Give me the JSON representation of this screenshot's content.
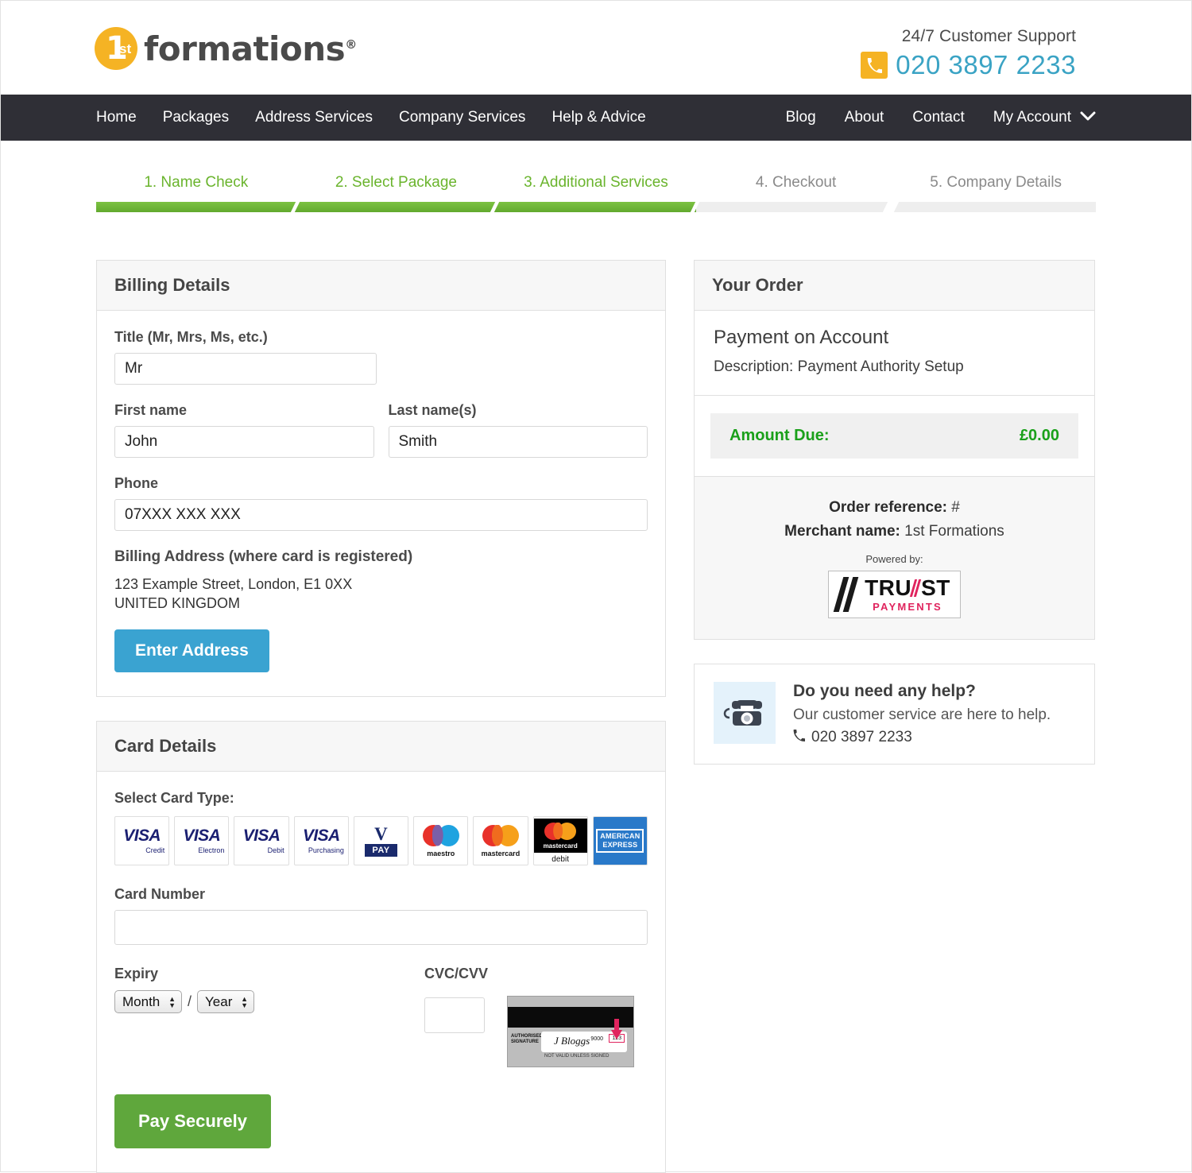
{
  "header": {
    "logo_digit": "1",
    "logo_sup": "st",
    "logo_word": "formations",
    "logo_registered": "®",
    "support_label": "24/7 Customer Support",
    "support_phone": "020 3897 2233",
    "phone_icon": "phone-icon",
    "accent_yellow": "#f5b324",
    "phone_blue": "#3aa3c4"
  },
  "nav": {
    "left_items": [
      "Home",
      "Packages",
      "Address Services",
      "Company Services",
      "Help & Advice"
    ],
    "right_items": [
      "Blog",
      "About",
      "Contact",
      "My Account"
    ],
    "caret_icon": "chevron-down-icon",
    "background": "#2f2f36"
  },
  "steps": {
    "items": [
      {
        "label": "1. Name Check",
        "state": "done"
      },
      {
        "label": "2. Select Package",
        "state": "done"
      },
      {
        "label": "3. Additional Services",
        "state": "done"
      },
      {
        "label": "4. Checkout",
        "state": "pending"
      },
      {
        "label": "5. Company Details",
        "state": "pending"
      }
    ],
    "done_color": "#6ab42d",
    "pending_color": "#8a8a8a"
  },
  "billing": {
    "panel_title": "Billing Details",
    "title_label": "Title (Mr, Mrs, Ms, etc.)",
    "title_value": "Mr",
    "first_name_label": "First name",
    "first_name_value": "John",
    "last_name_label": "Last name(s)",
    "last_name_value": "Smith",
    "phone_label": "Phone",
    "phone_value": "07XXX XXX XXX",
    "address_label": "Billing Address (where card is registered)",
    "address_line1": "123 Example Street, London, E1 0XX",
    "address_line2": "UNITED KINGDOM",
    "enter_address_button": "Enter Address",
    "button_color": "#3aa3d1"
  },
  "card": {
    "panel_title": "Card Details",
    "select_card_label": "Select Card Type:",
    "types": [
      {
        "name": "visa-credit",
        "brand": "VISA",
        "sub": "Credit"
      },
      {
        "name": "visa-electron",
        "brand": "VISA",
        "sub": "Electron"
      },
      {
        "name": "visa-debit",
        "brand": "VISA",
        "sub": "Debit"
      },
      {
        "name": "visa-purchasing",
        "brand": "VISA",
        "sub": "Purchasing"
      },
      {
        "name": "v-pay",
        "brand": "V",
        "sub": "PAY"
      },
      {
        "name": "maestro",
        "brand": "",
        "sub": "maestro"
      },
      {
        "name": "mastercard",
        "brand": "",
        "sub": "mastercard"
      },
      {
        "name": "mastercard-debit",
        "brand": "mastercard",
        "sub": "debit"
      },
      {
        "name": "american-express",
        "brand": "AMERICAN",
        "sub": "EXPRESS"
      }
    ],
    "card_number_label": "Card Number",
    "card_number_value": "",
    "expiry_label": "Expiry",
    "month_placeholder": "Month",
    "year_placeholder": "Year",
    "expiry_separator": "/",
    "cvc_label": "CVC/CVV",
    "cvc_value": "",
    "cvc_card": {
      "auth_text": "AUTHORISED SIGNATURE",
      "signature": "J Bloggs",
      "number_fragment": "9000",
      "cvc_digits": "123",
      "footer": "NOT VALID UNLESS SIGNED"
    },
    "pay_button": "Pay Securely",
    "pay_button_color": "#5fa73c"
  },
  "order": {
    "panel_title": "Your Order",
    "item_title": "Payment on Account",
    "item_desc": "Description: Payment Authority Setup",
    "amount_label": "Amount Due:",
    "amount_value": "£0.00",
    "amount_color": "#1aa01a",
    "order_reference_label": "Order reference:",
    "order_reference_value": "#",
    "merchant_label": "Merchant name:",
    "merchant_value": "1st Formations",
    "powered_by": "Powered by:",
    "provider_top_a": "TRU",
    "provider_top_b": "ST",
    "provider_bottom": "PAYMENTS",
    "provider_accent": "#e0245e"
  },
  "help": {
    "icon": "telephone-icon",
    "title": "Do you need any help?",
    "subtitle": "Our customer service are here to help.",
    "phone_icon": "phone-handset-icon",
    "phone": "020 3897 2233"
  }
}
